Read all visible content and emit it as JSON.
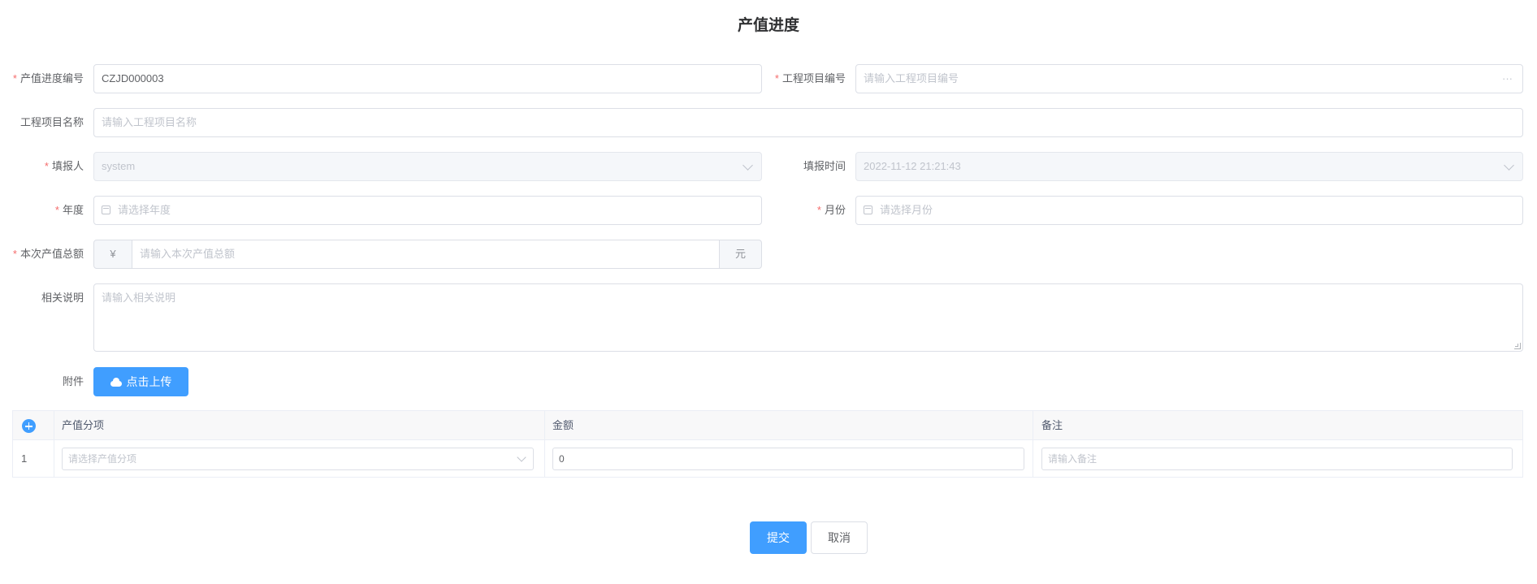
{
  "page": {
    "title": "产值进度"
  },
  "form": {
    "code": {
      "label": "产值进度编号",
      "value": "CZJD000003"
    },
    "project_code": {
      "label": "工程项目编号",
      "placeholder": "请输入工程项目编号",
      "suffix": "···"
    },
    "project_name": {
      "label": "工程项目名称",
      "placeholder": "请输入工程项目名称"
    },
    "reporter": {
      "label": "填报人",
      "value": "system"
    },
    "report_time": {
      "label": "填报时间",
      "value": "2022-11-12 21:21:43"
    },
    "year": {
      "label": "年度",
      "placeholder": "请选择年度"
    },
    "month": {
      "label": "月份",
      "placeholder": "请选择月份"
    },
    "total": {
      "label": "本次产值总额",
      "prefix": "¥",
      "placeholder": "请输入本次产值总额",
      "suffix": "元"
    },
    "description": {
      "label": "相关说明",
      "placeholder": "请输入相关说明"
    },
    "attachment": {
      "label": "附件",
      "button": "点击上传"
    },
    "required_mark": "*"
  },
  "table": {
    "headers": [
      "产值分项",
      "金额",
      "备注"
    ],
    "rows": [
      {
        "index": "1",
        "item_placeholder": "请选择产值分项",
        "amount": "0",
        "remark_placeholder": "请输入备注"
      }
    ]
  },
  "actions": {
    "submit": "提交",
    "cancel": "取消"
  },
  "colors": {
    "primary": "#409eff",
    "required": "#f56c6c",
    "border": "#dcdfe6"
  }
}
